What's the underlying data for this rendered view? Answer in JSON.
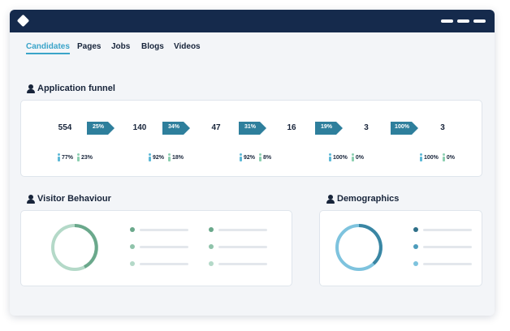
{
  "nav": {
    "tabs": [
      "Candidates",
      "Pages",
      "Jobs",
      "Blogs",
      "Videos"
    ],
    "active": "Candidates"
  },
  "funnel": {
    "title": "Application funnel",
    "stages": [
      {
        "count": "554",
        "male": "77%",
        "female": "23%"
      },
      {
        "count": "140",
        "male": "92%",
        "female": "18%"
      },
      {
        "count": "47",
        "male": "92%",
        "female": "8%"
      },
      {
        "count": "16",
        "male": "100%",
        "female": "0%"
      },
      {
        "count": "3",
        "male": "100%",
        "female": "0%"
      },
      {
        "count": "3"
      }
    ],
    "conversions": [
      "25%",
      "34%",
      "31%",
      "19%",
      "100%"
    ]
  },
  "visitor": {
    "title": "Visitor Behaviour"
  },
  "demographics": {
    "title": "Demographics"
  },
  "colors": {
    "navy": "#152a4c",
    "accent": "#3aa4c9",
    "arrow": "#2e7f9c",
    "green_dark": "#6aa88b",
    "green_light": "#b4d9c8",
    "blue_dark": "#3a86a3",
    "blue_light": "#7ec3de"
  }
}
